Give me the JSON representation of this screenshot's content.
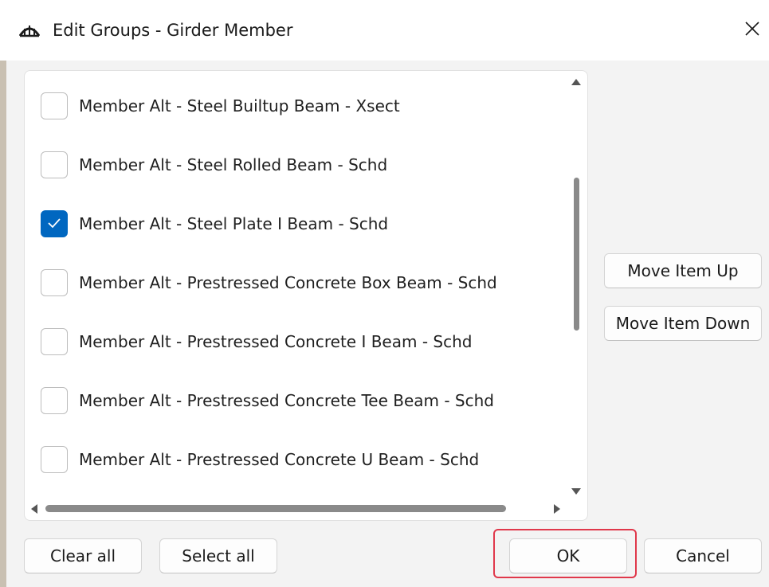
{
  "window": {
    "title": "Edit Groups - Girder Member",
    "app_icon": "bridge-arch-icon",
    "close_icon": "close-icon"
  },
  "list": {
    "items": [
      {
        "label": "Member Alt - Steel Builtup Beam - Xsect",
        "checked": false
      },
      {
        "label": "Member Alt - Steel Rolled Beam - Schd",
        "checked": false
      },
      {
        "label": "Member Alt - Steel Plate I Beam - Schd",
        "checked": true
      },
      {
        "label": "Member Alt - Prestressed Concrete Box Beam - Schd",
        "checked": false
      },
      {
        "label": "Member Alt - Prestressed Concrete I Beam - Schd",
        "checked": false
      },
      {
        "label": "Member Alt - Prestressed Concrete Tee Beam - Schd",
        "checked": false
      },
      {
        "label": "Member Alt - Prestressed Concrete U Beam - Schd",
        "checked": false
      }
    ]
  },
  "side_buttons": {
    "move_up": "Move Item Up",
    "move_down": "Move Item Down"
  },
  "footer": {
    "clear_all": "Clear all",
    "select_all": "Select all",
    "ok": "OK",
    "cancel": "Cancel"
  },
  "colors": {
    "accent": "#0067c0",
    "highlight": "#e0384b"
  }
}
